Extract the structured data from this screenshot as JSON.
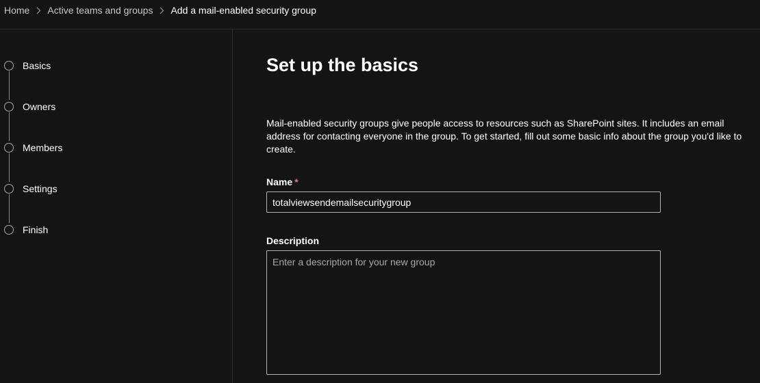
{
  "breadcrumb": {
    "items": [
      {
        "label": "Home"
      },
      {
        "label": "Active teams and groups"
      },
      {
        "label": "Add a mail-enabled security group"
      }
    ]
  },
  "wizard": {
    "steps": [
      {
        "label": "Basics"
      },
      {
        "label": "Owners"
      },
      {
        "label": "Members"
      },
      {
        "label": "Settings"
      },
      {
        "label": "Finish"
      }
    ]
  },
  "main": {
    "title": "Set up the basics",
    "intro": "Mail-enabled security groups give people access to resources such as SharePoint sites. It includes an email address for contacting everyone in the group. To get started, fill out some basic info about the group you'd like to create.",
    "name_field": {
      "label": "Name",
      "required_marker": "*",
      "value": "totalviewsendemailsecuritygroup"
    },
    "description_field": {
      "label": "Description",
      "placeholder": "Enter a description for your new group",
      "value": ""
    }
  },
  "colors": {
    "background": "#141414",
    "divider": "#2e2e2e",
    "required": "#f1707b",
    "input_border": "#b3b3b3"
  },
  "icons": {
    "breadcrumb_separator": "chevron-right-icon",
    "step_marker": "step-circle-icon"
  }
}
